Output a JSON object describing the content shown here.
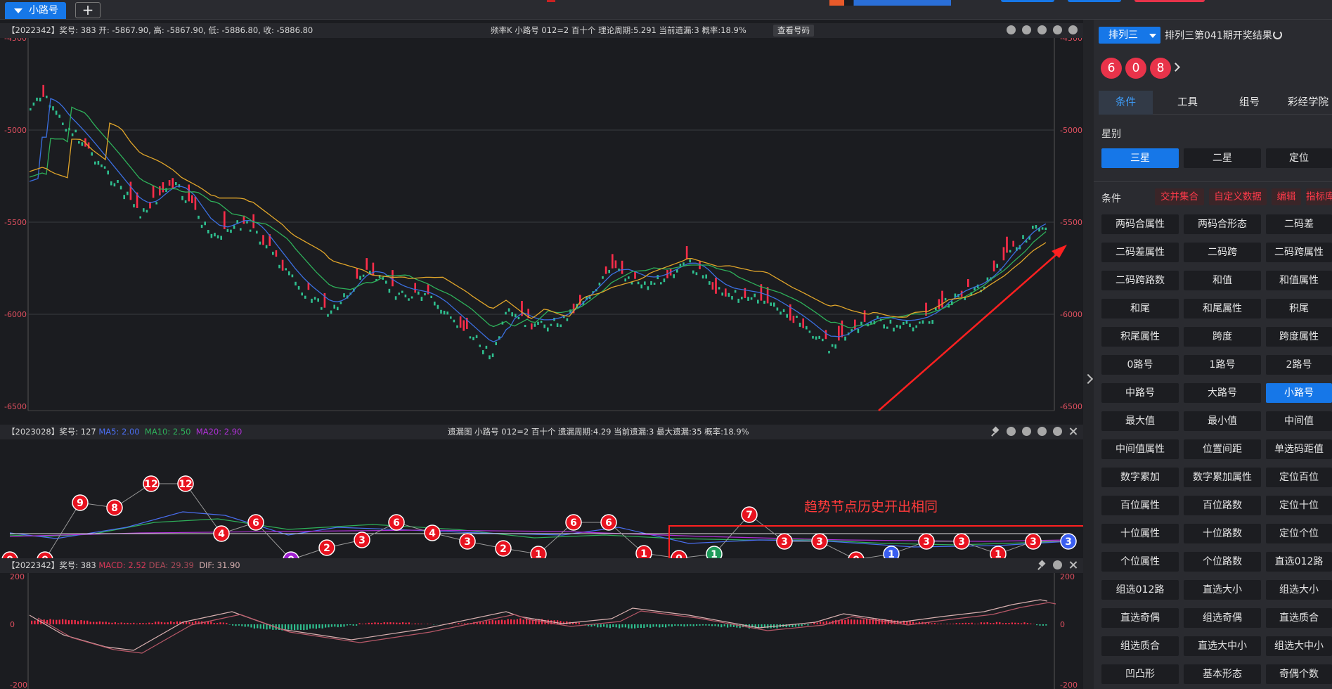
{
  "tab": {
    "label": "小路号"
  },
  "plus_label": "+",
  "colors": {
    "accent": "#1677e8",
    "up": "#ff2d4a",
    "down": "#2fbf8f",
    "ma5": "#3b6fe0",
    "ma10": "#2eb05a",
    "ma20": "#e0a52a",
    "ma_purple": "#9b2fd0",
    "annot": "#ff2020"
  },
  "k_panel": {
    "info_left": "【2022342】奖号: 383  开: -5867.90, 高: -5867.90, 低: -5886.80, 收: -5886.80",
    "info_center": "频率K  小路号  012=2  百十个  理论周期:5.291  当前遗漏:3  概率:18.9%",
    "lookup_btn": "查看号码",
    "y_labels": [
      "-4500",
      "-5000",
      "-5500",
      "-6000",
      "-6500"
    ]
  },
  "miss_panel": {
    "info_left": "【2023028】奖号: 127",
    "ma5": "MA5: 2.00",
    "ma10": "MA10: 2.50",
    "ma20": "MA20: 2.90",
    "info_center": "遗漏图  小路号  012=2  百十个  遗漏周期:4.29  当前遗漏:3  最大遗漏:35  概率:18.9%",
    "nodes": [
      "0",
      "0",
      "9",
      "8",
      "12",
      "12",
      "4",
      "6",
      "0",
      "2",
      "3",
      "6",
      "4",
      "3",
      "2",
      "1",
      "6",
      "6",
      "1",
      "0",
      "1",
      "7",
      "3",
      "3",
      "0",
      "1",
      "3",
      "3",
      "1",
      "3",
      "3"
    ],
    "annotation": "趋势节点历史开出相同"
  },
  "macd_panel": {
    "info_left": "【2022342】奖号: 383",
    "macd": "MACD: 2.52",
    "dea": "DEA: 29.39",
    "dif": "DIF: 31.90",
    "y_labels": [
      "200",
      "0",
      "-200"
    ]
  },
  "sidebar": {
    "lottery_select": "排列三",
    "draw_title": "排列三第041期开奖结果",
    "balls": [
      "6",
      "0",
      "8"
    ],
    "tabs": [
      "条件",
      "工具",
      "组号",
      "彩经学院"
    ],
    "star_label": "星别",
    "star_opts": [
      "三星",
      "二星",
      "定位"
    ],
    "cond_label": "条件",
    "cond_btns": [
      "交并集合",
      "自定义数据",
      "编辑",
      "指标库"
    ],
    "options": [
      "两码合属性",
      "两码合形态",
      "二码差",
      "二码差属性",
      "二码跨",
      "二码跨属性",
      "二码跨路数",
      "和值",
      "和值属性",
      "和尾",
      "和尾属性",
      "积尾",
      "积尾属性",
      "跨度",
      "跨度属性",
      "0路号",
      "1路号",
      "2路号",
      "中路号",
      "大路号",
      "小路号",
      "最大值",
      "最小值",
      "中间值",
      "中间值属性",
      "位置间距",
      "单选码距值",
      "数字累加",
      "数字累加属性",
      "定位百位",
      "百位属性",
      "百位路数",
      "定位十位",
      "十位属性",
      "十位路数",
      "定位个位",
      "个位属性",
      "个位路数",
      "直选012路",
      "组选012路",
      "直选大小",
      "组选大小",
      "直选奇偶",
      "组选奇偶",
      "直选质合",
      "组选质合",
      "直选大中小",
      "组选大中小",
      "凹凸形",
      "基本形态",
      "奇偶个数"
    ]
  }
}
